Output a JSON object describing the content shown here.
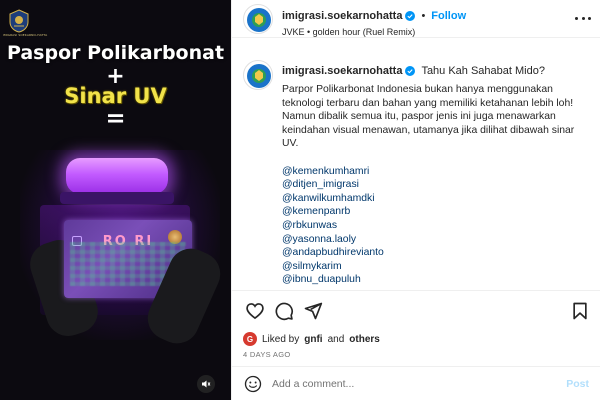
{
  "media": {
    "logo_text": "IMIGRASI SOEKARNO-HATTA",
    "line1": "Paspor Polikarbonat",
    "line2": "+",
    "line3": "Sinar UV",
    "line4": "=",
    "passport_text": "RO  RI",
    "mute_icon": "speaker-muted-icon"
  },
  "header": {
    "username": "imigrasi.soekarnohatta",
    "separator": "•",
    "follow_label": "Follow",
    "audio": "JVKE • golden hour (Ruel Remix)",
    "more_icon": "more-options-icon"
  },
  "caption": {
    "username": "imigrasi.soekarnohatta",
    "title": "Tahu Kah Sahabat Mido?",
    "paragraph": "Parpor Polikarbonat Indonesia bukan hanya menggunakan teknologi terbaru dan bahan yang memiliki ketahanan lebih loh! Namun dibalik semua itu, paspor jenis ini juga menawarkan keindahan visual menawan, utamanya jika dilihat dibawah sinar UV.",
    "mentions": [
      "@kemenkumhamri",
      "@ditjen_imigrasi",
      "@kanwilkumhamdki",
      "@kemenpanrb",
      "@rbkunwas",
      "@yasonna.laoly",
      "@andapbudhirevianto",
      "@silmykarim",
      "@ibnu_duapuluh"
    ]
  },
  "actions": {
    "like_icon": "heart-icon",
    "comment_icon": "comment-icon",
    "share_icon": "share-icon",
    "save_icon": "bookmark-icon"
  },
  "likes": {
    "prefix": "Liked by",
    "user": "gnfi",
    "connector": "and",
    "suffix": "others",
    "avatar_letter": "G"
  },
  "time_ago": "4 DAYS AGO",
  "comment": {
    "placeholder": "Add a comment...",
    "post_label": "Post"
  },
  "colors": {
    "accent": "#0095f6",
    "link": "#00376b",
    "post_disabled": "#b2dffc",
    "uv_purple": "#9a2ee6",
    "headline_yellow": "#f2e34a"
  }
}
